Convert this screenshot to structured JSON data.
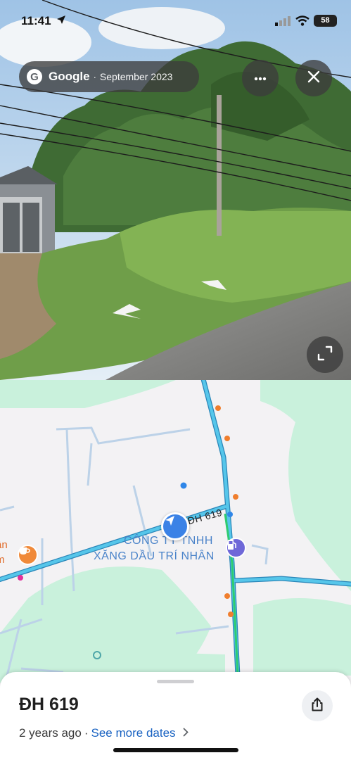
{
  "status_bar": {
    "time": "11:41",
    "battery": "58"
  },
  "street_view": {
    "brand": "Google",
    "separator": "·",
    "date": "September 2023",
    "more_icon": "ellipsis-icon",
    "close_icon": "close-icon",
    "expand_icon": "expand-icon"
  },
  "map": {
    "road_label": "ĐH 619",
    "poi_name_line1": "CÔNG TY TNHH",
    "poi_name_line2": "XĂNG DẦU TRÍ NHÂN",
    "poi_left_line1": "ân",
    "poi_left_line2": "m",
    "colors": {
      "road": "#56b9de",
      "route": "#2ecc71",
      "green_area": "#c9f1dc",
      "land": "#f3f2f4"
    }
  },
  "sheet": {
    "title": "ĐH 619",
    "age": "2 years ago",
    "separator": "·",
    "see_more": "See more dates",
    "share_icon": "share-icon"
  }
}
